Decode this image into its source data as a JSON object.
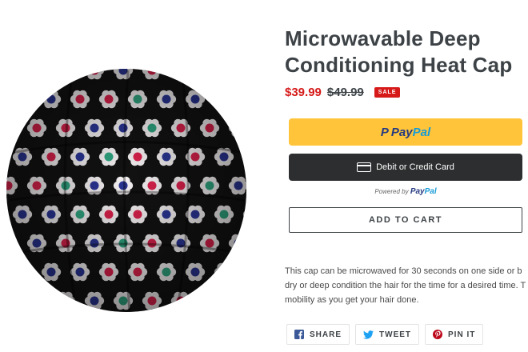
{
  "product": {
    "title": "Microwavable Deep Conditioning Heat Cap",
    "sale_price": "$39.99",
    "regular_price": "$49.99",
    "sale_badge": "SALE",
    "description_lines": [
      "This cap can be microwaved for 30 seconds on one side or b",
      "dry or deep condition the hair for the time for a desired time. T",
      "mobility as you get your hair done."
    ]
  },
  "checkout": {
    "paypal_p": "Pay",
    "paypal_pal": "Pal",
    "card_label": "Debit or Credit Card",
    "powered_by": "Powered by",
    "add_to_cart": "ADD TO CART"
  },
  "share": {
    "facebook": "SHARE",
    "twitter": "TWEET",
    "pinterest": "PIN IT"
  },
  "colors": {
    "sale_red": "#d61a1a",
    "paypal_yellow": "#ffc439",
    "card_dark": "#2c2e2f",
    "paypal_blue_dark": "#253b80",
    "paypal_blue_light": "#179bd7"
  },
  "icons": [
    "paypal-logo-icon",
    "credit-card-icon",
    "facebook-icon",
    "twitter-icon",
    "pinterest-icon"
  ]
}
